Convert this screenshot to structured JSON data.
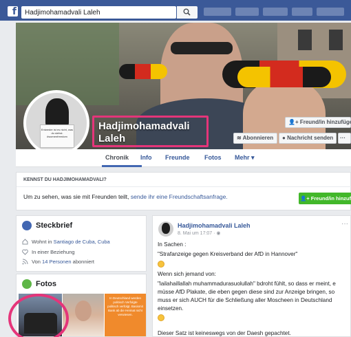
{
  "topbar": {
    "search_value": "Hadjimohamadvali Laleh",
    "logo": "f",
    "icons": [
      "facebook-logo-icon",
      "search-icon"
    ]
  },
  "profile": {
    "name_line1": "Hadjimohamadvali",
    "name_line2": "Laleh",
    "avatar_sign_text": "Entweder ist es nicht, was du siehst. #womenfreedom"
  },
  "cover_buttons": {
    "add_friend": "Freund/in hinzufügen",
    "follow": "Abonnieren",
    "message": "Nachricht senden",
    "more": "···"
  },
  "tabs": [
    {
      "label": "Chronik",
      "active": true
    },
    {
      "label": "Info",
      "active": false
    },
    {
      "label": "Freunde",
      "active": false
    },
    {
      "label": "Fotos",
      "active": false
    },
    {
      "label": "Mehr ▾",
      "active": false
    }
  ],
  "know": {
    "title": "KENNST DU HADJIMOHAMADVALI?",
    "text_prefix": "Um zu sehen, was sie mit Freunden teilt,",
    "text_link": "sende ihr eine Freundschaftsanfrage.",
    "button": "Freund/in hinzufügen"
  },
  "intro": {
    "title": "Steckbrief",
    "rows": [
      {
        "prefix": "Wohnt in",
        "link": "Santiago de Cuba, Cuba",
        "suffix": ""
      },
      {
        "prefix": "In einer Beziehung",
        "link": "",
        "suffix": ""
      },
      {
        "prefix": "Von",
        "link": "14 Personen",
        "suffix": "abonniert"
      }
    ]
  },
  "photos": {
    "title": "Fotos",
    "thumb3_text": "In Deutschland werden politisch Verfolgte politisch verfolgt. Basismit Bank ab die Heimat nicht verwiesen."
  },
  "post": {
    "author": "Hadjimohamadvali Laleh",
    "meta": "8. Mai um 17:07 · ",
    "menu": "···",
    "lines": [
      "In Sachen :",
      "\"Strafanzeige gegen Kreisverband der AfD in Hannover\"",
      "Wenn sich jemand von:",
      "\"lailahaillallah muhammadurasuolullah\" bdroht fühlt, so dass er meint, e",
      "müsse AfD Plakate, die eben gegen diese sind zur Anzeige bringen, so",
      "muss er sich AUCH für die Schließung aller Moscheen in Deutschland",
      "einsetzen.",
      "Dieser Satz ist keineswegs von der Daesh gepachtet."
    ]
  },
  "colors": {
    "topbar": "#3b5998",
    "link": "#365899",
    "green_button": "#42b72a",
    "highlight_pink": "#e5357a",
    "page_bg": "#e9ebee"
  }
}
